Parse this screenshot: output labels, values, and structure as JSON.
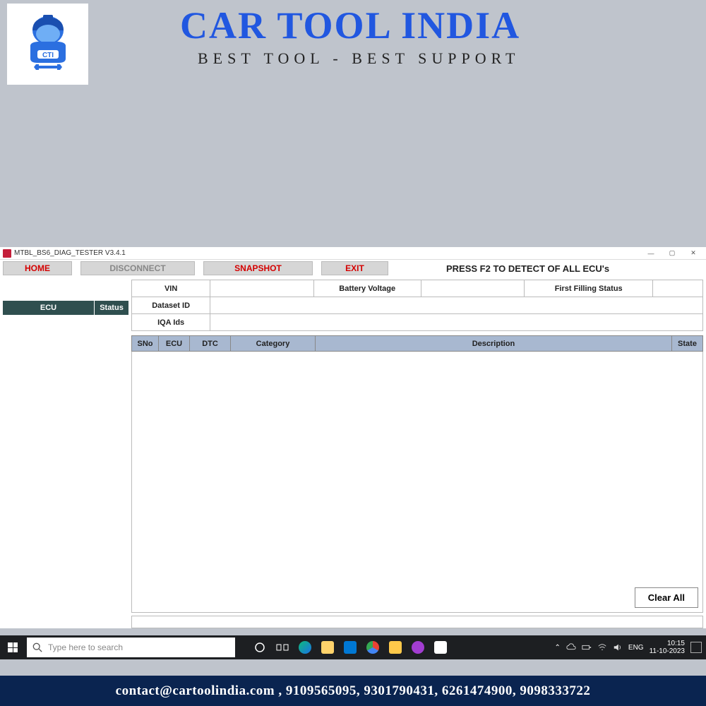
{
  "brand": {
    "title": "CAR TOOL INDIA",
    "subtitle": "BEST TOOL - BEST SUPPORT",
    "logo_label": "CTI"
  },
  "window": {
    "title": "MTBL_BS6_DIAG_TESTER V3.4.1"
  },
  "toolbar": {
    "home": "HOME",
    "disconnect": "DISCONNECT",
    "snapshot": "SNAPSHOT",
    "exit": "EXIT",
    "hint": "PRESS F2 TO DETECT OF ALL ECU's"
  },
  "sidebar": {
    "ecu_header": "ECU",
    "status_header": "Status"
  },
  "info": {
    "vin_label": "VIN",
    "vin_value": "",
    "battery_label": "Battery Voltage",
    "battery_value": "",
    "filling_label": "First Filling Status",
    "filling_value": "",
    "dataset_label": "Dataset ID",
    "dataset_value": "",
    "iqa_label": "IQA Ids",
    "iqa_value": ""
  },
  "dtc_headers": {
    "sno": "SNo",
    "ecu": "ECU",
    "dtc": "DTC",
    "category": "Category",
    "description": "Description",
    "state": "State"
  },
  "buttons": {
    "clear_all": "Clear All"
  },
  "taskbar": {
    "search_placeholder": "Type here to search",
    "lang": "ENG",
    "time": "10:15",
    "date": "11-10-2023"
  },
  "footer": {
    "contact": "contact@cartoolindia.com , 9109565095, 9301790431, 6261474900, 9098333722"
  }
}
